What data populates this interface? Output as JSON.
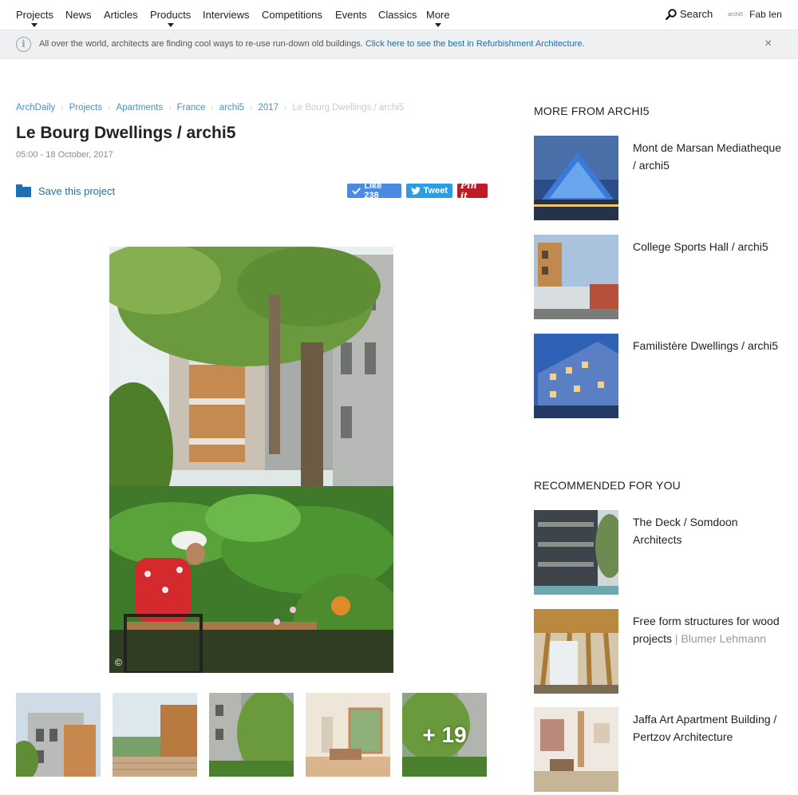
{
  "nav": {
    "items": [
      {
        "label": "Projects",
        "caret": true
      },
      {
        "label": "News",
        "caret": false
      },
      {
        "label": "Articles",
        "caret": false
      },
      {
        "label": "Products",
        "caret": true
      },
      {
        "label": "Interviews",
        "caret": false
      },
      {
        "label": "Competitions",
        "caret": false
      },
      {
        "label": "Events",
        "caret": false
      },
      {
        "label": "Classics",
        "caret": false
      },
      {
        "label": "More",
        "caret": true
      }
    ],
    "search_label": "Search",
    "user_logo": "archi5",
    "user_name": "Fab Ien"
  },
  "notice": {
    "text": "All over the world, architects are finding cool ways to re-use run-down old buildings.",
    "link": "Click here to see the best in Refurbishment Architecture.",
    "info_glyph": "i",
    "close_glyph": "×"
  },
  "breadcrumb": {
    "items": [
      "ArchDaily",
      "Projects",
      "Apartments",
      "France",
      "archi5",
      "2017"
    ],
    "current": "Le Bourg Dwellings / archi5",
    "separator": "›"
  },
  "project": {
    "title": "Le Bourg Dwellings / archi5",
    "date": "05:00 - 18 October, 2017",
    "save_label": "Save this project",
    "like_label": "Like 238",
    "tweet_label": "Tweet",
    "pin_label": "Pin it",
    "copyright_glyph": "©"
  },
  "gallery": {
    "more_label": "+ 19"
  },
  "sidebar": {
    "more_heading": "MORE FROM ARCHI5",
    "more_items": [
      {
        "title": "Mont de Marsan Mediatheque / archi5"
      },
      {
        "title": "College Sports Hall / archi5"
      },
      {
        "title": "Familistère Dwellings / archi5"
      }
    ],
    "rec_heading": "RECOMMENDED FOR YOU",
    "rec_items": [
      {
        "title": "The Deck / Somdoon Architects",
        "suffix": ""
      },
      {
        "title": "Free form structures for wood projects",
        "suffix": "| Blumer Lehmann"
      },
      {
        "title": "Jaffa Art Apartment Building / Pertzov Architecture",
        "suffix": ""
      }
    ]
  },
  "colors": {
    "link_blue": "#1e6ea8",
    "like_blue": "#4a8ae0",
    "tweet_blue": "#2b9de6",
    "pinterest_red": "#bf1b26"
  }
}
